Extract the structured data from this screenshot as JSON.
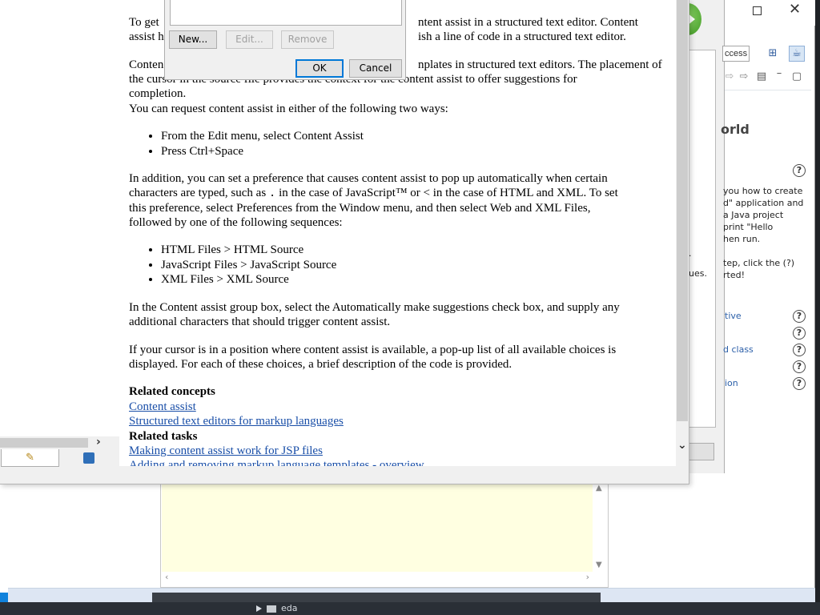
{
  "eclipse": {
    "quick_access_text": "ccess",
    "cheat_sheet": {
      "title_fragment": "orld",
      "description_lines": [
        "you how to create",
        "d\" application and",
        "a Java project",
        "print \"Hello",
        "hen run."
      ],
      "step_lines": [
        "tep, click the (?)",
        "rted!"
      ],
      "fragment_ues": "ues.",
      "fragment_dot": ".",
      "links": [
        "tive",
        "d class",
        "ion"
      ],
      "help_icon_glyph": "?"
    },
    "window_controls": {
      "maximize": "maximize-icon",
      "close_glyph": "✕"
    }
  },
  "taskbar": {
    "item_label": "eda"
  },
  "templates_dialog": {
    "buttons": {
      "new": "New...",
      "edit": "Edit...",
      "remove": "Remove",
      "ok": "OK",
      "cancel": "Cancel"
    }
  },
  "help_window": {
    "left_tabs": [
      {
        "icon": "bookmark-pencil-icon",
        "glyph": "✎"
      },
      {
        "icon": "book-icon",
        "glyph": "📘"
      }
    ],
    "scroll_right_glyph": "›",
    "scroll_down_glyph": "⌄"
  },
  "document": {
    "p1_lead": "To get",
    "p1_tail_line1": "ntent assist in a structured text editor. Content",
    "p1_lead_line2": "assist h",
    "p1_tail_line2": "ish a line of code in a structured text editor.",
    "p2_lead": "Conten",
    "p2_tail_line1": "nplates in structured text editors. The placement of",
    "p2_line2": "the cursor in the source file provides the context for the content assist to offer suggestions for",
    "p2_line3": "completion.",
    "p3": "You can request content assist in either of the following two ways:",
    "ways": [
      "From the Edit menu, select Content Assist",
      "Press Ctrl+Space"
    ],
    "p4_line1": "In addition, you can set a preference that causes content assist to pop up automatically when certain",
    "p4_line2_a": "characters are typed, such as ",
    "p4_line2_code": ".",
    "p4_line2_b": " in the case of JavaScript™ or < in the case of HTML and XML. To set",
    "p4_line3": "this preference, select Preferences from the Window menu, and then select Web and XML Files,",
    "p4_line4": "followed by one of the following sequences:",
    "sequences": [
      "HTML Files > HTML Source",
      "JavaScript Files > JavaScript Source",
      "XML Files > XML Source"
    ],
    "p5_line1": "In the Content assist group box, select the Automatically make suggestions check box, and supply any",
    "p5_line2": "additional characters that should trigger content assist.",
    "p6_line1": "If your cursor is in a position where content assist is available, a pop-up list of all available choices is",
    "p6_line2": "displayed. For each of these choices, a brief description of the code is provided.",
    "related_concepts_heading": "Related concepts",
    "related_concepts": [
      "Content assist",
      "Structured text editors for markup languages"
    ],
    "related_tasks_heading": "Related tasks",
    "related_tasks": [
      "Making content assist work for JSP files",
      "Adding and removing markup language templates - overview"
    ]
  }
}
